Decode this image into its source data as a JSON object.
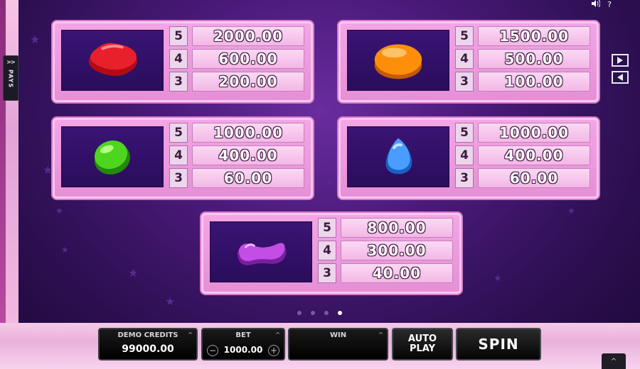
{
  "header": {
    "sound_icon": "speaker-icon",
    "help_label": "?"
  },
  "side_tab": {
    "arrows": ">>",
    "label": "PAYS"
  },
  "paytable": [
    {
      "symbol": "red-candy",
      "color": "#e01828",
      "rows": [
        {
          "count": "5",
          "payout": "2000.00"
        },
        {
          "count": "4",
          "payout": "600.00"
        },
        {
          "count": "3",
          "payout": "200.00"
        }
      ]
    },
    {
      "symbol": "orange-candy",
      "color": "#ff8c00",
      "rows": [
        {
          "count": "5",
          "payout": "1500.00"
        },
        {
          "count": "4",
          "payout": "500.00"
        },
        {
          "count": "3",
          "payout": "100.00"
        }
      ]
    },
    {
      "symbol": "green-candy",
      "color": "#3fc81e",
      "rows": [
        {
          "count": "5",
          "payout": "1000.00"
        },
        {
          "count": "4",
          "payout": "400.00"
        },
        {
          "count": "3",
          "payout": "60.00"
        }
      ]
    },
    {
      "symbol": "blue-candy",
      "color": "#3d8ef5",
      "rows": [
        {
          "count": "5",
          "payout": "1000.00"
        },
        {
          "count": "4",
          "payout": "400.00"
        },
        {
          "count": "3",
          "payout": "60.00"
        }
      ]
    },
    {
      "symbol": "purple-candy",
      "color": "#b84ad8",
      "rows": [
        {
          "count": "5",
          "payout": "800.00"
        },
        {
          "count": "4",
          "payout": "300.00"
        },
        {
          "count": "3",
          "payout": "40.00"
        }
      ]
    }
  ],
  "pagination": {
    "total": 4,
    "active": 4
  },
  "controls": {
    "credits_label": "DEMO CREDITS",
    "credits_value": "99000.00",
    "bet_label": "BET",
    "bet_value": "1000.00",
    "bet_minus": "−",
    "bet_plus": "+",
    "win_label": "WIN",
    "win_value": "",
    "auto_play_label": "AUTO PLAY",
    "spin_label": "SPIN",
    "corner_label": "^"
  }
}
